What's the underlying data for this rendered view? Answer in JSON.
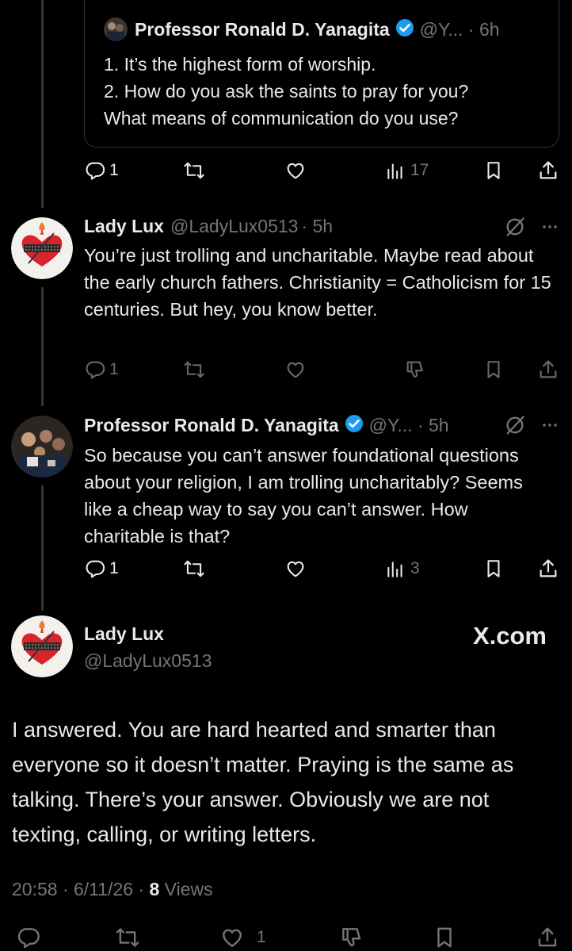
{
  "quote_tweet": {
    "name": "Professor Ronald D. Yanagita",
    "handle_time": "@Y... · 6h",
    "lines": [
      "1. It’s the highest form of worship.",
      "2. How do you ask the saints to pray for you?",
      "What means of communication do you use?"
    ],
    "actions": {
      "replies": "1",
      "views": "17"
    }
  },
  "reply1": {
    "name": "Lady Lux",
    "handle": "@LadyLux0513",
    "time": "· 5h",
    "text": "You’re just trolling and uncharitable. Maybe read about the early church fathers. Christianity = Catholicism for 15 centuries. But hey, you know better.",
    "actions": {
      "replies": "1"
    }
  },
  "reply2": {
    "name": "Professor Ronald D. Yanagita",
    "handle_time": "@Y... · 5h",
    "text": "So because you can’t answer foundational questions about your religion, I am trolling uncharitably? Seems like a cheap way to say you can’t answer. How charitable is that?",
    "actions": {
      "replies": "1",
      "views": "3"
    }
  },
  "main_tweet": {
    "name": "Lady Lux",
    "handle": "@LadyLux0513",
    "watermark": "X.com",
    "text": "I answered. You are hard hearted and smarter than everyone so it doesn’t matter. Praying is the same as talking. There’s your answer. Obviously we are not texting, calling, or writing letters.",
    "time_date": "20:58 · 6/11/26 ·",
    "views_count": "8",
    "views_label": "Views",
    "likes": "1"
  },
  "icons": [
    "reply-icon",
    "retweet-icon",
    "like-icon",
    "views-icon",
    "bookmark-icon",
    "share-icon",
    "dislike-icon",
    "muted-conversation-icon",
    "more-icon",
    "verified-badge-icon"
  ],
  "colors": {
    "background": "#000000",
    "text": "#e7e9ea",
    "muted": "#71767b",
    "verified": "#1d9bf0",
    "heart_red": "#d8242b"
  }
}
